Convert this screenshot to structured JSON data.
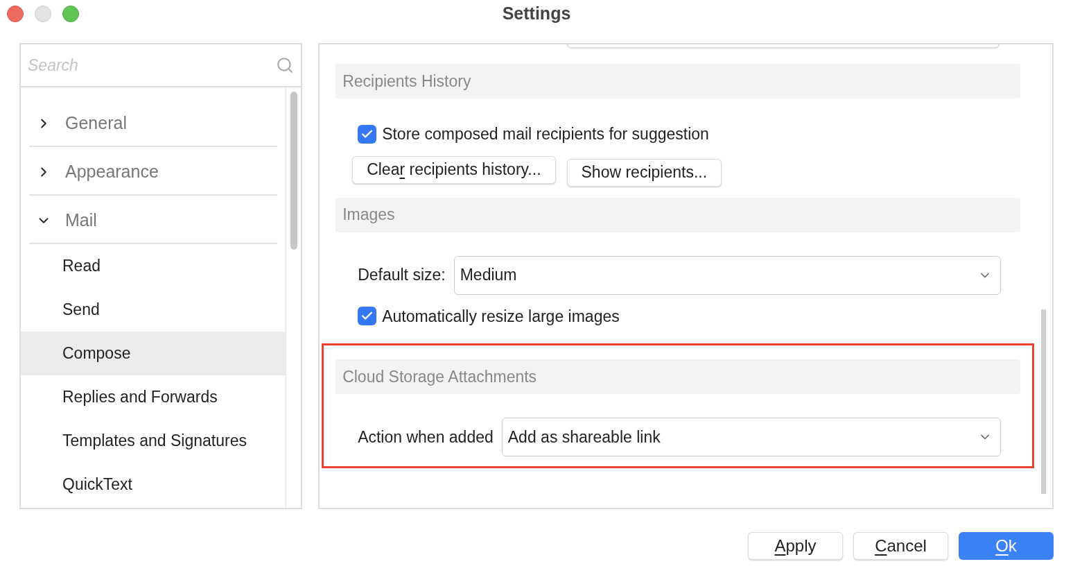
{
  "window": {
    "title": "Settings"
  },
  "search": {
    "placeholder": "Search"
  },
  "sidebar": {
    "items": [
      {
        "label": "General",
        "expanded": false
      },
      {
        "label": "Appearance",
        "expanded": false
      },
      {
        "label": "Mail",
        "expanded": true,
        "children": [
          {
            "label": "Read",
            "selected": false
          },
          {
            "label": "Send",
            "selected": false
          },
          {
            "label": "Compose",
            "selected": true
          },
          {
            "label": "Replies and Forwards",
            "selected": false
          },
          {
            "label": "Templates and Signatures",
            "selected": false
          },
          {
            "label": "QuickText",
            "selected": false
          }
        ]
      }
    ]
  },
  "sections": [
    {
      "title": "Recipients History",
      "highlighted": false,
      "rows": [
        {
          "kind": "checkbox",
          "label": "Store composed mail recipients for suggestion",
          "checked": true
        },
        {
          "kind": "buttons",
          "buttons": [
            {
              "pre": "Clea",
              "key": "r",
              "post": " recipients history..."
            },
            {
              "pre": "Show recipients..."
            }
          ]
        }
      ]
    },
    {
      "title": "Images",
      "highlighted": false,
      "rows": [
        {
          "kind": "select",
          "label": "Default size:",
          "value": "Medium"
        },
        {
          "kind": "checkbox",
          "label": "Automatically resize large images",
          "checked": true
        }
      ]
    },
    {
      "title": "Cloud Storage Attachments",
      "highlighted": true,
      "rows": [
        {
          "kind": "select",
          "label": "Action when added",
          "value": "Add as shareable link"
        }
      ]
    }
  ],
  "buttons": [
    {
      "key": "A",
      "post": "pply",
      "primary": false
    },
    {
      "key": "C",
      "post": "ancel",
      "primary": false
    },
    {
      "key": "O",
      "post": "k",
      "primary": true
    }
  ]
}
